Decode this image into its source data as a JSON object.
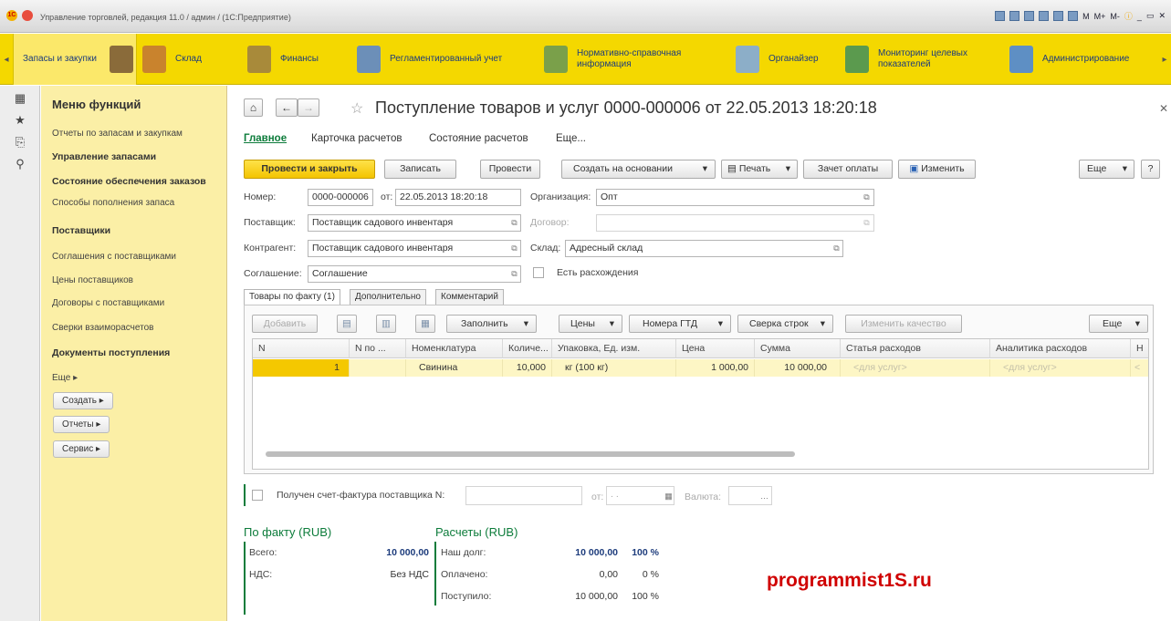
{
  "window": {
    "title": "Управление торговлей, редакция 11.0 / админ /  (1С:Предприятие)",
    "tools": [
      "M",
      "M+",
      "M-"
    ]
  },
  "sections": [
    {
      "label": "Запасы и закупки",
      "active": true,
      "icon": "shelf-icon",
      "color": "#8a6b3a"
    },
    {
      "label": "Склад",
      "active": false,
      "icon": "warehouse-boxes-icon",
      "color": "#c9832d"
    },
    {
      "label": "Финансы",
      "active": false,
      "icon": "finance-coins-icon",
      "color": "#a88a3a"
    },
    {
      "label": "Регламентированный учет",
      "active": false,
      "icon": "ledger-icon",
      "color": "#6c8fb8"
    },
    {
      "label": "Нормативно-справочная информация",
      "active": false,
      "icon": "reference-books-icon",
      "color": "#7aa04a"
    },
    {
      "label": "Органайзер",
      "active": false,
      "icon": "organizer-icon",
      "color": "#8caec8"
    },
    {
      "label": "Мониторинг целевых показателей",
      "active": false,
      "icon": "monitoring-chart-icon",
      "color": "#5b9a4e"
    },
    {
      "label": "Администрирование",
      "active": false,
      "icon": "administration-computer-icon",
      "color": "#5e8fc4"
    }
  ],
  "left_icons": [
    "apps-grid-icon",
    "favorites-star-icon",
    "history-icon",
    "search-icon"
  ],
  "func_menu": {
    "title": "Меню функций",
    "items": [
      {
        "label": "Отчеты по запасам и закупкам",
        "bold": false
      },
      {
        "label": "Управление запасами",
        "bold": true
      },
      {
        "label": "Состояние обеспечения заказов",
        "bold": true
      },
      {
        "label": "Способы пополнения запаса",
        "bold": false
      },
      {
        "label": "Поставщики",
        "bold": true
      },
      {
        "label": "Соглашения с поставщиками",
        "bold": false
      },
      {
        "label": "Цены поставщиков",
        "bold": false
      },
      {
        "label": "Договоры с поставщиками",
        "bold": false
      },
      {
        "label": "Сверки взаиморасчетов",
        "bold": false
      },
      {
        "label": "Документы поступления",
        "bold": true
      },
      {
        "label": "Еще ▸",
        "bold": false
      }
    ],
    "buttons": [
      "Создать ▸",
      "Отчеты ▸",
      "Сервис ▸"
    ]
  },
  "doc": {
    "title": "Поступление товаров и услуг 0000-000006 от 22.05.2013 18:20:18",
    "tabs": [
      "Главное",
      "Карточка расчетов",
      "Состояние расчетов",
      "Еще..."
    ],
    "toolbar": {
      "post_close": "Провести и закрыть",
      "save": "Записать",
      "post": "Провести",
      "create_based": "Создать на основании",
      "print": "Печать",
      "payment_offset": "Зачет оплаты",
      "edit": "Изменить",
      "more": "Еще",
      "help": "?"
    },
    "fields": {
      "number_label": "Номер:",
      "number": "0000-000006",
      "date_label": "от:",
      "date": "22.05.2013 18:20:18",
      "org_label": "Организация:",
      "org": "Опт",
      "supplier_label": "Поставщик:",
      "supplier": "Поставщик садового инвентаря",
      "contract_label": "Договор:",
      "contract": "",
      "counterparty_label": "Контрагент:",
      "counterparty": "Поставщик садового инвентаря",
      "warehouse_label": "Склад:",
      "warehouse": "Адресный склад",
      "agreement_label": "Соглашение:",
      "agreement": "Соглашение",
      "discrepancy_label": "Есть расхождения"
    },
    "inner_tabs": [
      "Товары по факту (1)",
      "Дополнительно",
      "Комментарий"
    ],
    "table_toolbar": {
      "add": "Добавить",
      "fill": "Заполнить",
      "prices": "Цены",
      "gtd": "Номера ГТД",
      "reconcile": "Сверка строк",
      "quality": "Изменить качество",
      "more": "Еще"
    },
    "columns": [
      "N",
      "N по ...",
      "Номенклатура",
      "Количе...",
      "Упаковка, Ед. изм.",
      "Цена",
      "Сумма",
      "Статья расходов",
      "Аналитика расходов",
      "Н"
    ],
    "rows": [
      {
        "n": "1",
        "n_po": "",
        "item": "Свинина",
        "qty": "10,000",
        "pack": "кг (100 кг)",
        "price": "1 000,00",
        "sum": "10 000,00",
        "expense": "<для услуг>",
        "analytics": "<для услуг>"
      }
    ],
    "invoice": {
      "label": "Получен счет-фактура поставщика N:",
      "date_label": "от:",
      "date_mask": ". .",
      "currency_label": "Валюта:"
    },
    "totals": {
      "fact_title": "По факту (RUB)",
      "total_label": "Всего:",
      "total": "10 000,00",
      "vat_label": "НДС:",
      "vat": "Без НДС",
      "calc_title": "Расчеты (RUB)",
      "debt_label": "Наш долг:",
      "debt": "10 000,00",
      "debt_pct": "100 %",
      "paid_label": "Оплачено:",
      "paid": "0,00",
      "paid_pct": "0 %",
      "received_label": "Поступило:",
      "received": "10 000,00",
      "received_pct": "100 %"
    }
  },
  "watermark": "programmist1S.ru"
}
